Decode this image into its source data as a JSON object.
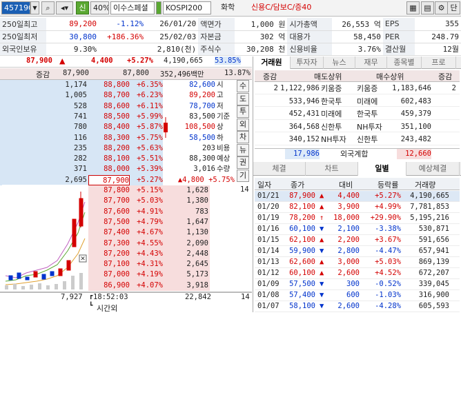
{
  "topbar": {
    "code": "457190",
    "company": "이수스페셜",
    "badge": "신",
    "margin": "40%",
    "index": "KOSPI200",
    "sector": "화학",
    "credit": "신용C/담보C/증40",
    "btn_last": "단"
  },
  "info": [
    [
      "250일최고",
      "89,200",
      "-1.12%",
      "26/01/20",
      "액면가",
      "1,000 원",
      "시가총액",
      "26,553 억",
      "EPS",
      "355"
    ],
    [
      "250일최저",
      "30,800",
      "+186.36%",
      "25/02/03",
      "자본금",
      "302 억",
      "대용가",
      "58,450",
      "PER",
      "248.79"
    ],
    [
      "외국인보유",
      "9.30%",
      "",
      "2,810(천)",
      "주식수",
      "30,208 천",
      "신용비율",
      "3.76%",
      "결산월",
      "12월"
    ]
  ],
  "quote": {
    "price": "87,900",
    "arrow": "▲",
    "change": "4,400",
    "pct": "+5.27%",
    "volume": "4,190,665",
    "turnover": "53.85%"
  },
  "order_header": {
    "label": "증감",
    "sell_total": "87,900",
    "buy_total": "87,800",
    "amount": "352,496백만",
    "ratio": "13.87%"
  },
  "asks": [
    {
      "qty": "1,174",
      "price": "88,800",
      "pct": "+6.35%"
    },
    {
      "qty": "1,005",
      "price": "88,700",
      "pct": "+6.23%"
    },
    {
      "qty": "528",
      "price": "88,600",
      "pct": "+6.11%"
    },
    {
      "qty": "741",
      "price": "88,500",
      "pct": "+5.99%"
    },
    {
      "qty": "780",
      "price": "88,400",
      "pct": "+5.87%"
    },
    {
      "qty": "116",
      "price": "88,300",
      "pct": "+5.75%"
    },
    {
      "qty": "235",
      "price": "88,200",
      "pct": "+5.63%"
    },
    {
      "qty": "282",
      "price": "88,100",
      "pct": "+5.51%"
    },
    {
      "qty": "371",
      "price": "88,000",
      "pct": "+5.39%"
    },
    {
      "qty": "2,695",
      "price": "87,900",
      "pct": "+5.27%"
    }
  ],
  "summary": [
    {
      "label": "시",
      "value": "82,600"
    },
    {
      "label": "고",
      "value": "89,200"
    },
    {
      "label": "저",
      "value": "78,700"
    },
    {
      "label": "기준",
      "value": "83,500"
    },
    {
      "label": "상",
      "value": "108,500"
    },
    {
      "label": "하",
      "value": "58,500"
    },
    {
      "label": "비용",
      "value": "203"
    },
    {
      "label": "예상",
      "value": "88,300"
    },
    {
      "label": "수량",
      "value": "3,016"
    },
    {
      "label": "",
      "value": "▲4,800  +5.75%"
    }
  ],
  "vtabs": [
    "수",
    "도",
    "투",
    "외",
    "차",
    "뉴",
    "권",
    "기"
  ],
  "bids": [
    {
      "price": "87,800",
      "pct": "+5.15%",
      "qty": "1,628"
    },
    {
      "price": "87,700",
      "pct": "+5.03%",
      "qty": "1,380"
    },
    {
      "price": "87,600",
      "pct": "+4.91%",
      "qty": "783"
    },
    {
      "price": "87,500",
      "pct": "+4.79%",
      "qty": "1,647"
    },
    {
      "price": "87,400",
      "pct": "+4.67%",
      "qty": "1,130"
    },
    {
      "price": "87,300",
      "pct": "+4.55%",
      "qty": "2,090"
    },
    {
      "price": "87,200",
      "pct": "+4.43%",
      "qty": "2,448"
    },
    {
      "price": "87,100",
      "pct": "+4.31%",
      "qty": "2,645"
    },
    {
      "price": "87,000",
      "pct": "+4.19%",
      "qty": "5,173"
    },
    {
      "price": "86,900",
      "pct": "+4.07%",
      "qty": "3,918"
    }
  ],
  "bid_side_mark": "14",
  "bottom": {
    "ask_total": "7,927",
    "time": "18:52:03",
    "bid_total": "22,842",
    "mark": "14",
    "after_label": "시간외"
  },
  "broker_tabs": [
    "거래원",
    "투자자",
    "뉴스",
    "재무",
    "종목별",
    "프로"
  ],
  "broker_header": {
    "c1": "증감",
    "c2": "매도상위",
    "c3": "매수상위",
    "c4": "증감"
  },
  "brokers": [
    {
      "lchg": "2",
      "sqty": "1,122,986",
      "sname": "키움증",
      "bname": "키움증",
      "bqty": "1,183,646",
      "rchg": "2"
    },
    {
      "lchg": "",
      "sqty": "533,946",
      "sname": "한국투",
      "bname": "미래에",
      "bqty": "602,483",
      "rchg": ""
    },
    {
      "lchg": "",
      "sqty": "452,431",
      "sname": "미래에",
      "bname": "한국투",
      "bqty": "459,379",
      "rchg": ""
    },
    {
      "lchg": "",
      "sqty": "364,568",
      "sname": "신한투",
      "bname": "NH투자",
      "bqty": "351,100",
      "rchg": ""
    },
    {
      "lchg": "",
      "sqty": "340,152",
      "sname": "NH투자",
      "bname": "신한투",
      "bqty": "243,482",
      "rchg": ""
    }
  ],
  "foreign": {
    "sell": "17,986",
    "label": "외국계합",
    "buy": "12,660"
  },
  "daily_tabs": [
    "체결",
    "차트",
    "일별",
    "예상체결"
  ],
  "daily_header": [
    "일자",
    "종가",
    "대비",
    "등락률",
    "거래량"
  ],
  "daily": [
    {
      "date": "01/21",
      "close": "87,900",
      "dir": "▲",
      "chg": "4,400",
      "pct": "+5.27%",
      "vol": "4,190,665",
      "up": true,
      "sel": true
    },
    {
      "date": "01/20",
      "close": "82,100",
      "dir": "▲",
      "chg": "3,900",
      "pct": "+4.99%",
      "vol": "7,781,853",
      "up": true
    },
    {
      "date": "01/19",
      "close": "78,200",
      "dir": "↑",
      "chg": "18,000",
      "pct": "+29.90%",
      "vol": "5,195,216",
      "up": true
    },
    {
      "date": "01/16",
      "close": "60,100",
      "dir": "▼",
      "chg": "2,100",
      "pct": "-3.38%",
      "vol": "530,871",
      "up": false
    },
    {
      "date": "01/15",
      "close": "62,100",
      "dir": "▲",
      "chg": "2,200",
      "pct": "+3.67%",
      "vol": "591,656",
      "up": true
    },
    {
      "date": "01/14",
      "close": "59,900",
      "dir": "▼",
      "chg": "2,800",
      "pct": "-4.47%",
      "vol": "657,941",
      "up": false
    },
    {
      "date": "01/13",
      "close": "62,600",
      "dir": "▲",
      "chg": "3,000",
      "pct": "+5.03%",
      "vol": "869,139",
      "up": true
    },
    {
      "date": "01/12",
      "close": "60,100",
      "dir": "▲",
      "chg": "2,600",
      "pct": "+4.52%",
      "vol": "672,207",
      "up": true
    },
    {
      "date": "01/09",
      "close": "57,500",
      "dir": "▼",
      "chg": "300",
      "pct": "-0.52%",
      "vol": "339,045",
      "up": false
    },
    {
      "date": "01/08",
      "close": "57,400",
      "dir": "▼",
      "chg": "600",
      "pct": "-1.03%",
      "vol": "316,900",
      "up": false
    },
    {
      "date": "01/07",
      "close": "58,100",
      "dir": "▼",
      "chg": "2,600",
      "pct": "-4.28%",
      "vol": "605,593",
      "up": false
    }
  ],
  "colors": {
    "up": "#d40000",
    "down": "#0033cc",
    "ask_bg": "#d7e6f5",
    "bid_bg": "#f7dddd"
  }
}
